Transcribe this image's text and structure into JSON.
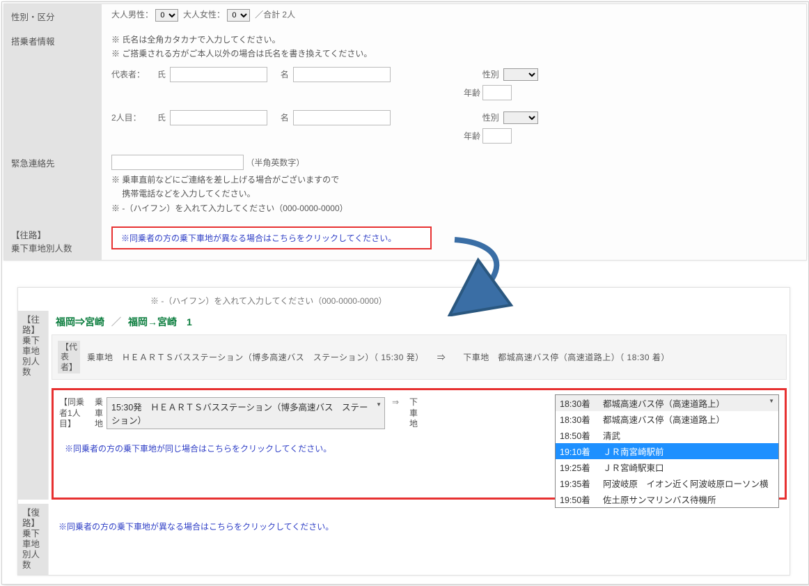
{
  "section1": {
    "gender_label": "性別・区分",
    "male_label": "大人男性：",
    "female_label": "大人女性：",
    "male_value": "0",
    "female_value": "0",
    "total_label": "／合計 2人",
    "passenger_label": "搭乗者情報",
    "note1": "※ 氏名は全角カタカナで入力してください。",
    "note2": "※ ご搭乗される方がご本人以外の場合は氏名を書き換えてください。",
    "rep_label": "代表者：",
    "p2_label": "2人目：",
    "shi_label": "氏",
    "mei_label": "名",
    "sex_label": "性別",
    "age_label": "年齢",
    "emergency_label": "緊急連絡先",
    "half_label": "（半角英数字）",
    "em_note1": "※ 乗車直前などにご連絡を差し上げる場合がございますので",
    "em_note2": "　  携帯電話などを入力してください。",
    "em_note3": "※ -（ハイフン）を入れて入力してください（000-0000-0000）",
    "route_label": "【往路】\n乗下車地別人数",
    "redbox_text": "※同乗者の方の乗下車地が異なる場合はこちらをクリックしてください。"
  },
  "section2": {
    "hyphen_note": "※ -（ハイフン）を入れて入力してください（000-0000-0000）",
    "oufuku_col": "【往路】乗下車地別人数",
    "fukuro_col": "【復路】乗下車地別人数",
    "route_a": "福岡⇒宮崎",
    "route_b": "福岡→宮崎　1",
    "daihyou_tag": "【代表者】",
    "daihyou_body": "乗車地　ＨＥＡＲＴＳバスステーション（博多高速バス　ステーション）（ 15:30 発）　　⇒　　下車地　都城高速バス停（高速道路上）（ 18:30 着）",
    "dojou_tag": "【同乗者1人目】",
    "board_col": "乗車地",
    "alight_col": "下車地",
    "board_select": "15:30発　ＨＥＡＲＴＳバスステーション（博多高速バス　ステーション）",
    "dropdown": [
      {
        "time": "18:30着",
        "name": "都城高速バス停（高速道路上）"
      },
      {
        "time": "18:30着",
        "name": "都城高速バス停（高速道路上）"
      },
      {
        "time": "18:50着",
        "name": "清武"
      },
      {
        "time": "19:10着",
        "name": "ＪＲ南宮崎駅前"
      },
      {
        "time": "19:25着",
        "name": "ＪＲ宮崎駅東口"
      },
      {
        "time": "19:35着",
        "name": "阿波岐原　イオン近く阿波岐原ローソン横"
      },
      {
        "time": "19:50着",
        "name": "佐土原サンマリンバス待機所"
      }
    ],
    "dropdown_highlight": 3,
    "same_note": "※同乗者の方の乗下車地が同じ場合はこちらをクリックしてください。",
    "diff_note": "※同乗者の方の乗下車地が異なる場合はこちらをクリックしてください。"
  }
}
